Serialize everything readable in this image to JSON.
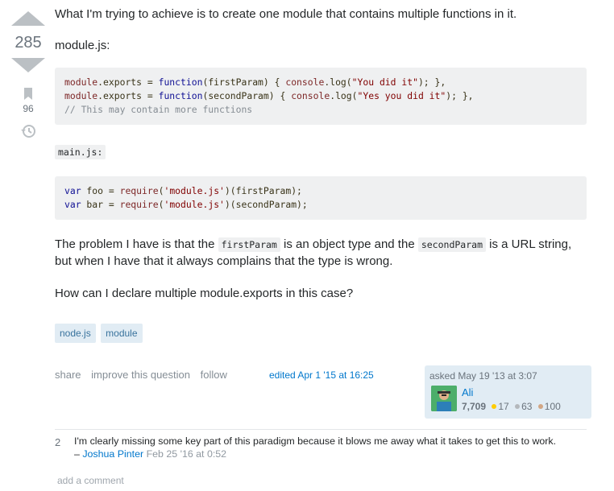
{
  "votes": {
    "score": "285",
    "favorites": "96"
  },
  "post": {
    "p1": "What I'm trying to achieve is to create one module that contains multiple functions in it.",
    "p2": "module.js:",
    "code1": [
      "module.exports = function(firstParam) { console.log(\"You did it\"); },",
      "module.exports = function(secondParam) { console.log(\"Yes you did it\"); },",
      "// This may contain more functions"
    ],
    "mainjs_label": "main.js:",
    "code2": [
      "var foo = require('module.js')(firstParam);",
      "var bar = require('module.js')(secondParam);"
    ],
    "p3_a": "The problem I have is that the ",
    "p3_code1": "firstParam",
    "p3_b": " is an object type and the ",
    "p3_code2": "secondParam",
    "p3_c": " is a URL string, but when I have that it always complains that the type is wrong.",
    "p4": "How can I declare multiple module.exports in this case?"
  },
  "tags": [
    "node.js",
    "module"
  ],
  "menu": {
    "share": "share",
    "improve": "improve this question",
    "follow": "follow"
  },
  "edited": "edited Apr 1 '15 at 16:25",
  "owner": {
    "asked": "asked May 19 '13 at 3:07",
    "name": "Ali",
    "reputation": "7,709",
    "gold": "17",
    "silver": "63",
    "bronze": "100",
    "badge_colors": {
      "gold": "#ffcc01",
      "silver": "#b4b8bc",
      "bronze": "#d1a684"
    }
  },
  "comments": [
    {
      "score": "2",
      "text": "I'm clearly missing some key part of this paradigm because it blows me away what it takes to get this to work.",
      "dash": " – ",
      "user": "Joshua Pinter",
      "date": "Feb 25 '16 at 0:52"
    }
  ],
  "add_comment": "add a comment"
}
